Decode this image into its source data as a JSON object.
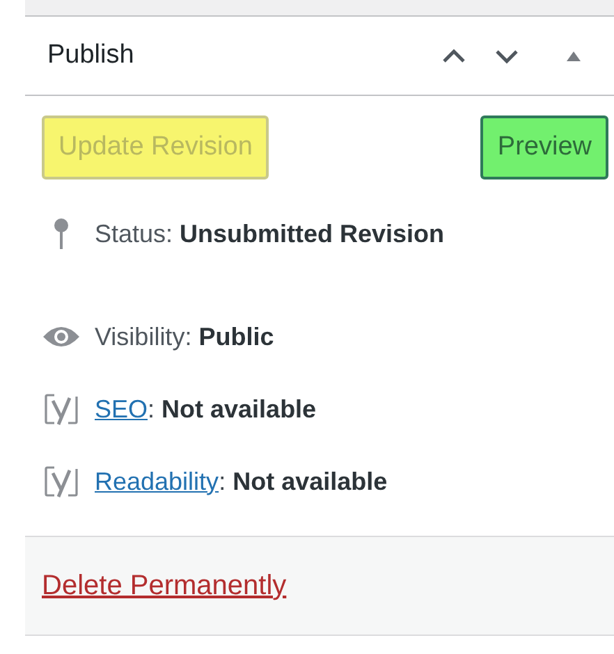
{
  "panel": {
    "title": "Publish",
    "expanded": true
  },
  "actions": [
    {
      "label": "Update Revision",
      "disabled": true,
      "color": "#f7f56e"
    },
    {
      "label": "Preview",
      "disabled": false,
      "color": "#72f06e"
    }
  ],
  "rows": [
    {
      "kind": "pin",
      "label": "Status",
      "link": false,
      "punct": ":",
      "value": "Unsubmitted Revision"
    },
    {
      "kind": "eye",
      "label": "Visibility",
      "link": false,
      "punct": ":",
      "value": "Public"
    },
    {
      "kind": "yoast",
      "label": "SEO",
      "link": true,
      "punct": ":",
      "value": "Not available"
    },
    {
      "kind": "yoast",
      "label": "Readability",
      "link": true,
      "punct": ":",
      "value": "Not available"
    }
  ],
  "footer": {
    "link": "Delete Permanently"
  }
}
